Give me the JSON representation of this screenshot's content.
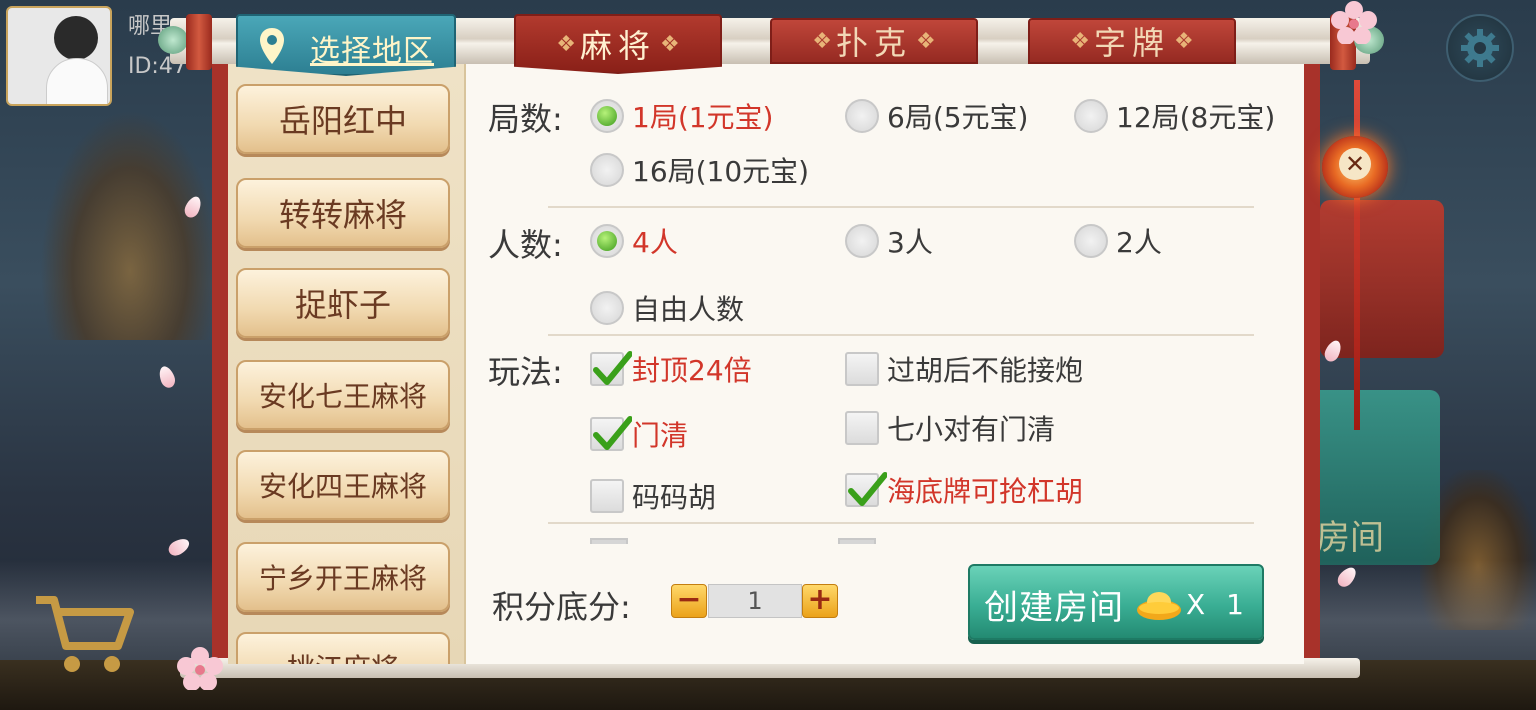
{
  "player": {
    "name": "哪里",
    "id": "ID:47"
  },
  "region_tab": {
    "label": "选择地区"
  },
  "tabs": [
    {
      "label": "麻将",
      "active": true
    },
    {
      "label": "扑克",
      "active": false
    },
    {
      "label": "字牌",
      "active": false
    }
  ],
  "sidebar": {
    "items": [
      {
        "label": "岳阳红中"
      },
      {
        "label": "转转麻将"
      },
      {
        "label": "捉虾子"
      },
      {
        "label": "安化七王麻将"
      },
      {
        "label": "安化四王麻将"
      },
      {
        "label": "宁乡开王麻将"
      },
      {
        "label": "桃江麻将"
      }
    ]
  },
  "rounds": {
    "label": "局数:",
    "options": [
      {
        "label": "1局(1元宝)",
        "selected": true
      },
      {
        "label": "6局(5元宝)",
        "selected": false
      },
      {
        "label": "12局(8元宝)",
        "selected": false
      },
      {
        "label": "16局(10元宝)",
        "selected": false
      }
    ]
  },
  "players": {
    "label": "人数:",
    "options": [
      {
        "label": "4人",
        "selected": true
      },
      {
        "label": "3人",
        "selected": false
      },
      {
        "label": "2人",
        "selected": false
      },
      {
        "label": "自由人数",
        "selected": false
      }
    ]
  },
  "rules": {
    "label": "玩法:",
    "options": [
      {
        "label": "封顶24倍",
        "checked": true
      },
      {
        "label": "过胡后不能接炮",
        "checked": false
      },
      {
        "label": "门清",
        "checked": true
      },
      {
        "label": "七小对有门清",
        "checked": false
      },
      {
        "label": "码码胡",
        "checked": false
      },
      {
        "label": "海底牌可抢杠胡",
        "checked": true
      }
    ]
  },
  "score": {
    "label": "积分底分:",
    "value": "1",
    "minus": "−",
    "plus": "+"
  },
  "create_button": {
    "label": "创建房间",
    "cost": "X 1"
  },
  "close": {
    "symbol": "✕"
  },
  "background": {
    "card_label": "房间"
  },
  "colors": {
    "accent_red": "#d2362a",
    "tab_red": "#a8322a",
    "create_green": "#3aae94",
    "region_teal": "#2d7f92"
  }
}
